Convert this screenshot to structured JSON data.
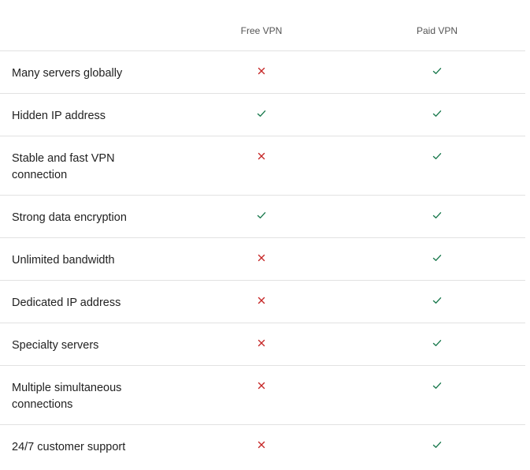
{
  "columns": {
    "feature": "",
    "free": "Free VPN",
    "paid": "Paid VPN"
  },
  "colors": {
    "check": "#1b7a4e",
    "cross": "#c62828",
    "divider": "#e2e2e2"
  },
  "rows": [
    {
      "feature": "Many servers globally",
      "free": "cross-icon",
      "paid": "check-icon"
    },
    {
      "feature": "Hidden IP address",
      "free": "check-icon",
      "paid": "check-icon"
    },
    {
      "feature": "Stable and fast VPN connection",
      "free": "cross-icon",
      "paid": "check-icon"
    },
    {
      "feature": "Strong data encryption",
      "free": "check-icon",
      "paid": "check-icon"
    },
    {
      "feature": "Unlimited bandwidth",
      "free": "cross-icon",
      "paid": "check-icon"
    },
    {
      "feature": "Dedicated IP address",
      "free": "cross-icon",
      "paid": "check-icon"
    },
    {
      "feature": "Specialty servers",
      "free": "cross-icon",
      "paid": "check-icon"
    },
    {
      "feature": "Multiple simultaneous connections",
      "free": "cross-icon",
      "paid": "check-icon"
    },
    {
      "feature": "24/7 customer support",
      "free": "cross-icon",
      "paid": "check-icon"
    }
  ]
}
